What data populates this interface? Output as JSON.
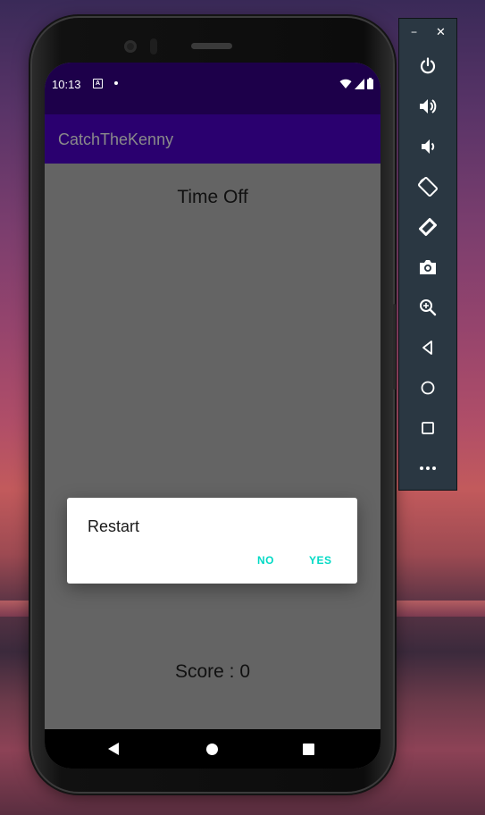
{
  "device": {
    "status_time": "10:13",
    "status_a_glyph": "A"
  },
  "app": {
    "title": "CatchTheKenny",
    "time_label": "Time Off",
    "score_label": "Score : 0"
  },
  "dialog": {
    "title": "Restart",
    "no_label": "NO",
    "yes_label": "YES"
  },
  "emulator_toolbar": {
    "minimize_glyph": "−",
    "close_glyph": "✕",
    "buttons": [
      "power-icon",
      "volume-up-icon",
      "volume-down-icon",
      "rotate-left-icon",
      "rotate-right-icon",
      "camera-icon",
      "zoom-icon",
      "back-icon",
      "home-icon",
      "overview-icon",
      "more-icon"
    ]
  },
  "colors": {
    "status_bar": "#1d004a",
    "app_bar": "#2a006f",
    "dialog_button": "#03dac5",
    "content_bg": "#646464",
    "toolbar_bg": "#2a3742"
  }
}
